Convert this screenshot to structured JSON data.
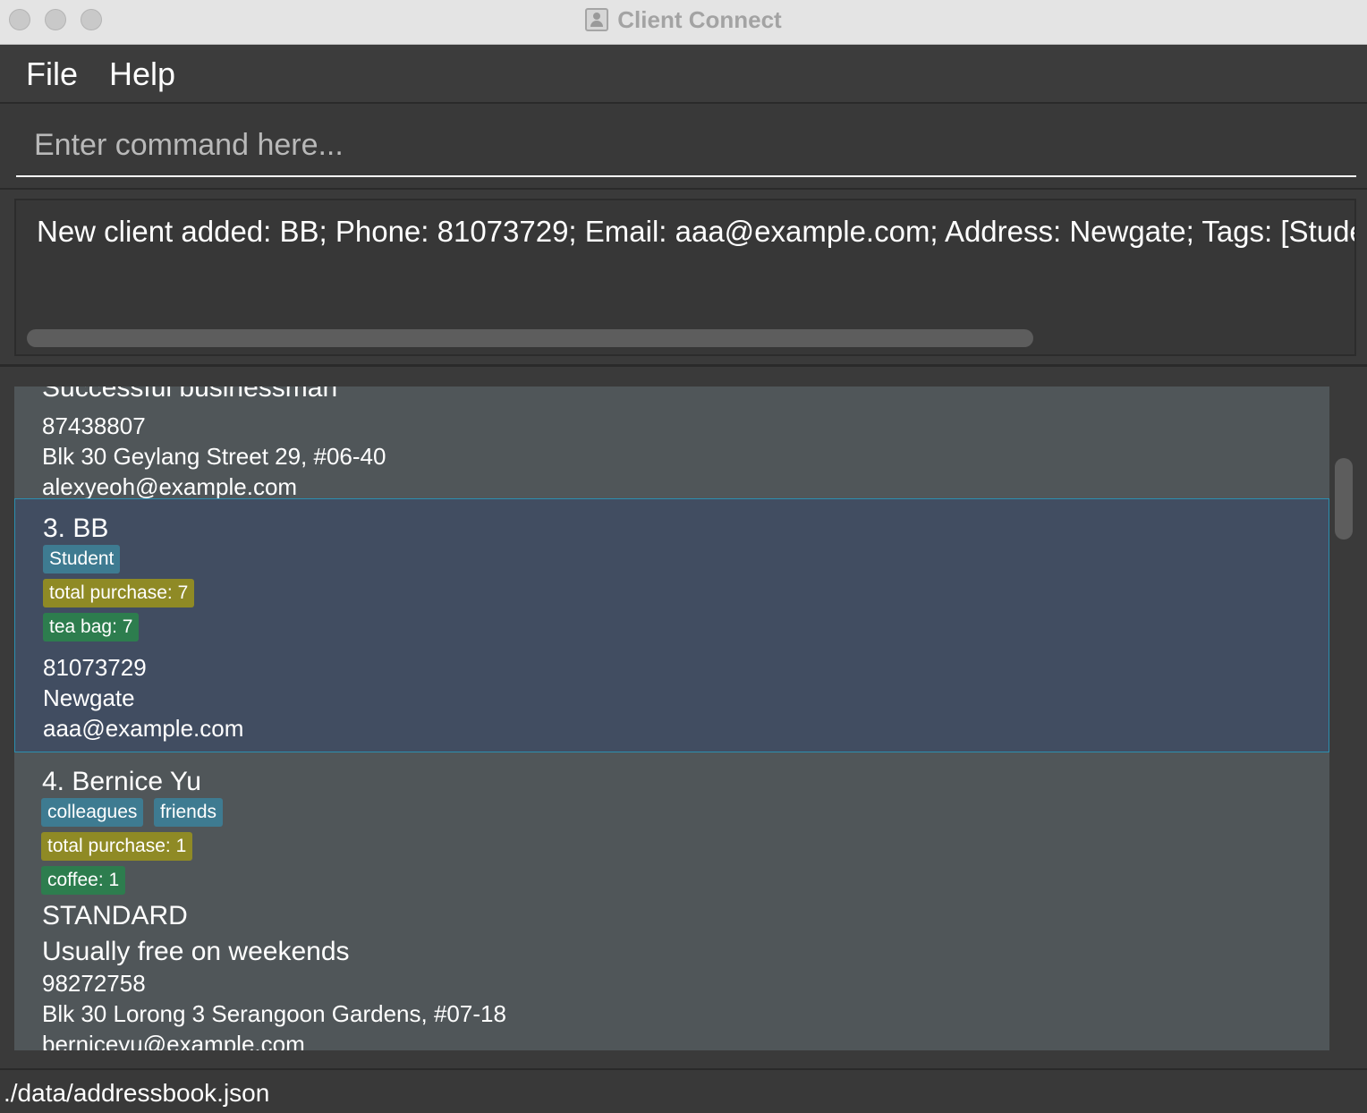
{
  "window": {
    "title": "Client Connect"
  },
  "menu": {
    "file": "File",
    "help": "Help"
  },
  "command": {
    "placeholder": "Enter command here...",
    "value": ""
  },
  "result": {
    "message": "New client added: BB; Phone: 81073729; Email: aaa@example.com; Address: Newgate; Tags: [Studen"
  },
  "clients": {
    "alex": {
      "note": "Successful businessman",
      "phone": "87438807",
      "address": "Blk 30 Geylang Street 29, #06-40",
      "email": "alexyeoh@example.com"
    },
    "bb": {
      "name": "3. BB",
      "tags": [
        "Student"
      ],
      "purchase": "total purchase: 7",
      "products": [
        "tea bag: 7"
      ],
      "phone": "81073729",
      "address": "Newgate",
      "email": "aaa@example.com"
    },
    "bernice": {
      "name": "4. Bernice Yu",
      "tags": [
        "colleagues",
        "friends"
      ],
      "purchase": "total purchase: 1",
      "products": [
        "coffee: 1"
      ],
      "membership": "STANDARD",
      "note": "Usually free on weekends",
      "phone": "98272758",
      "address": "Blk 30 Lorong 3 Serangoon Gardens, #07-18",
      "email": "berniceyu@example.com"
    }
  },
  "status": {
    "filepath": "./data/addressbook.json"
  },
  "colors": {
    "tag_blue": "#3e7b91",
    "tag_olive": "#8f8a25",
    "tag_green": "#2d7d4e",
    "card_selected": "#414d61",
    "selected_border": "#2b8fb0"
  }
}
